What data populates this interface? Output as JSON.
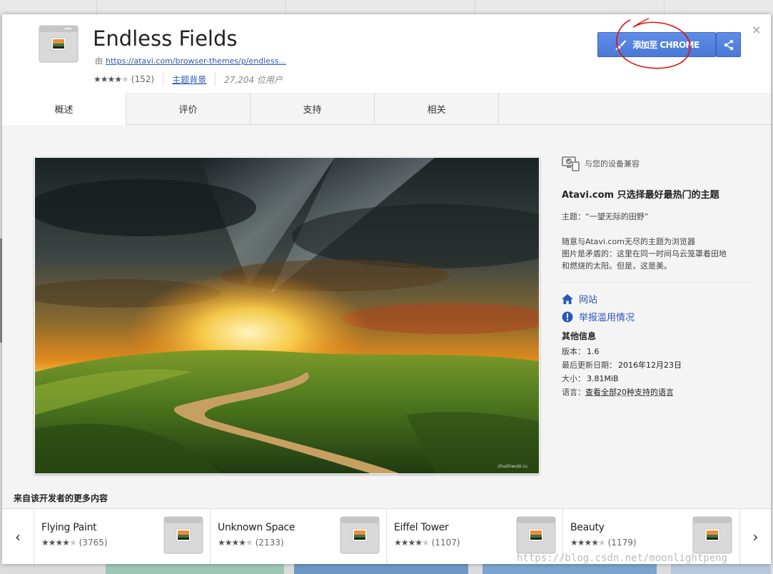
{
  "extension": {
    "title": "Endless Fields",
    "by_label": "由",
    "url": "https://atavi.com/browser-themes/p/endless...",
    "rating_count": "(152)",
    "category": "主题背景",
    "users": "27,204 位用户",
    "rating_stars": 4
  },
  "actions": {
    "add_label": "添加至 CHROME",
    "close": "×"
  },
  "tabs": [
    "概述",
    "评价",
    "支持",
    "相关"
  ],
  "sidebar": {
    "compat": "与您的设备兼容",
    "heading": "Atavi.com 只选择最好最热门的主题",
    "theme_line": "主题：“一望无际的田野”",
    "desc_1": "随意与Atavi.com无尽的主题为浏览器",
    "desc_2": "图片是矛盾的：这里在同一时间乌云笼罩着田地",
    "desc_3": "和燃烧的太阳。但是，这是美。",
    "website": "网站",
    "report": "举报滥用情况",
    "more_info": "其他信息",
    "version_label": "版本：",
    "version": "1.6",
    "updated_label": "最后更新日期：",
    "updated": "2016年12月23日",
    "size_label": "大小：",
    "size": "3.81MiB",
    "lang_label": "语言：",
    "lang_link": "查看全部20种支持的语言"
  },
  "screenshot_watermark": "zhuzhiwubi.ru",
  "more_from_dev": {
    "title": "来自该开发者的更多内容",
    "items": [
      {
        "name": "Flying Paint",
        "count": "(3765)",
        "stars": 4
      },
      {
        "name": "Unknown Space",
        "count": "(2133)",
        "stars": 4
      },
      {
        "name": "Eiffel Tower",
        "count": "(1107)",
        "stars": 4
      },
      {
        "name": "Beauty",
        "count": "(1179)",
        "stars": 4.5
      }
    ],
    "prev": "‹",
    "next": "›"
  },
  "page_watermark": "https://blog.csdn.net/moonlightpeng",
  "colors": {
    "accent": "#4a78d6",
    "link": "#2a58b8",
    "annotation": "#e01010"
  }
}
